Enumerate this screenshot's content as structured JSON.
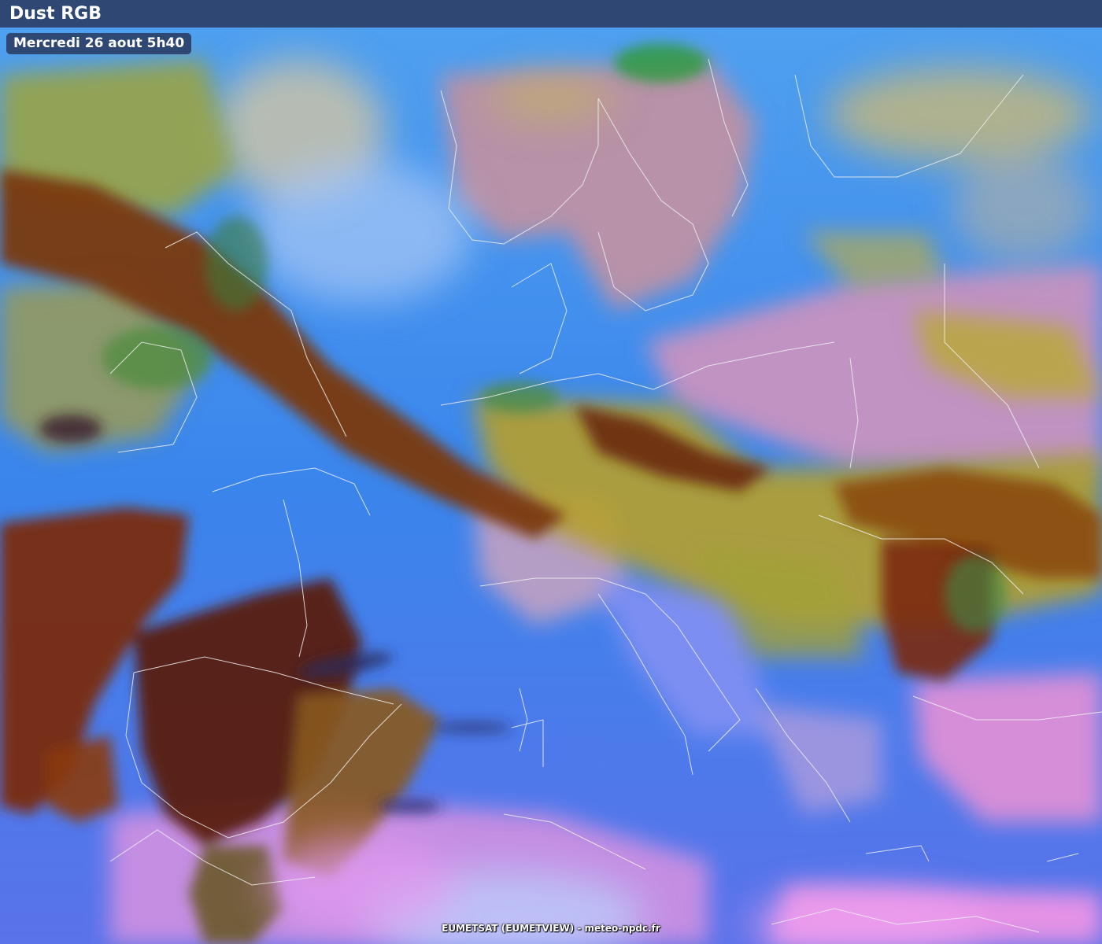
{
  "header": {
    "title": "Dust RGB"
  },
  "timestamp": {
    "label": "Mercredi 26 aout 5h40"
  },
  "credit": {
    "text": "EUMETSAT (EUMETVIEW) - meteo-npdc.fr"
  },
  "legend_colors": {
    "clear_sky": "#3a7be8",
    "thick_high_cloud": "#8a2a10",
    "mid_level_cloud": "#b39a2a",
    "low_cloud_desert": "#e48ee8",
    "cirrus": "#2d2d6e",
    "land_night": "#b88fb0",
    "borders": "#f0f0f0"
  }
}
